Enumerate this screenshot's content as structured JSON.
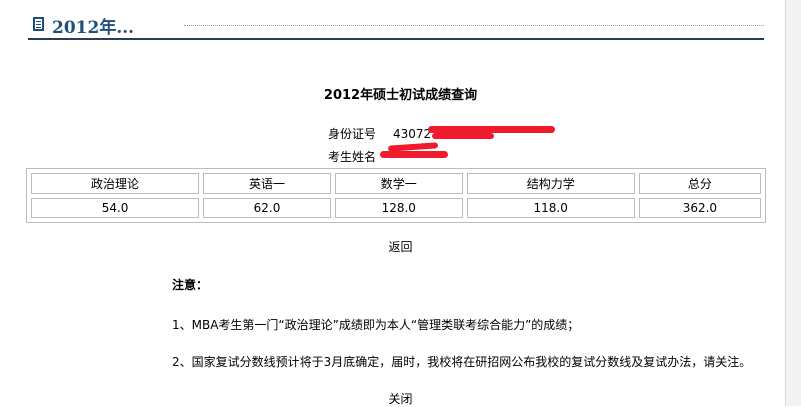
{
  "header": {
    "title": "2012年..."
  },
  "page_title": "2012年硕士初试成绩查询",
  "info": {
    "id_label": "身份证号",
    "id_value": "43072",
    "name_label": "考生姓名"
  },
  "scores": {
    "headers": [
      "政治理论",
      "英语一",
      "数学一",
      "结构力学",
      "总分"
    ],
    "values": [
      "54.0",
      "62.0",
      "128.0",
      "118.0",
      "362.0"
    ]
  },
  "back_label": "返回",
  "notes": {
    "title": "注意：",
    "items": [
      "1、MBA考生第一门“政治理论”成绩即为本人“管理类联考综合能力”的成绩；",
      "2、国家复试分数线预计将于3月底确定，届时，我校将在研招网公布我校的复试分数线及复试办法，请关注。"
    ]
  },
  "close_label": "关闭",
  "colors": {
    "header_text": "#1f4f7a",
    "header_rule": "#2a3e55",
    "redaction": "#ef1a2c",
    "table_border": "#bdbdbd"
  }
}
